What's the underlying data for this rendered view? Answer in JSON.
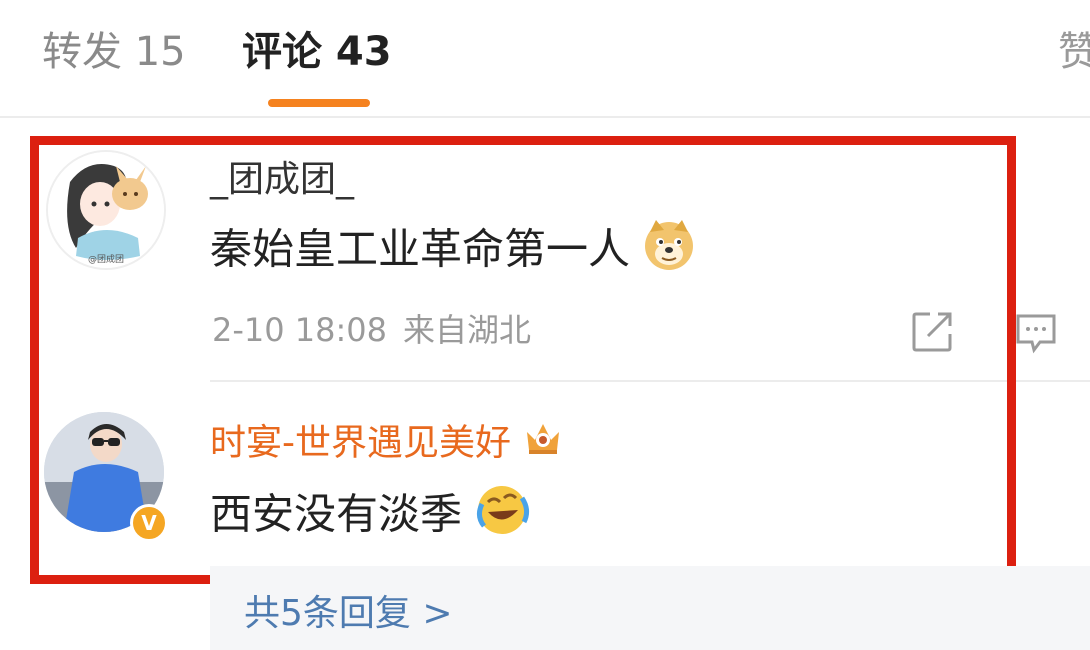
{
  "tabs": {
    "repost": "转发 15",
    "comments": "评论 43",
    "likes": "赞"
  },
  "comments": [
    {
      "username": "_团成团_",
      "text": "秦始皇工业革命第一人",
      "emoji": "doge-emoji",
      "date": "2-10 18:08",
      "location": "来自湖北"
    },
    {
      "username": "时宴-世界遇见美好",
      "text": "西安没有淡季",
      "emoji": "laugh-cry-emoji",
      "verified_badge": "V"
    }
  ],
  "replies": {
    "label": "共5条回复 >"
  },
  "colors": {
    "accent": "#f5821f",
    "highlight_border": "#dc2010",
    "vip_username": "#e8691e",
    "reply_link": "#4e7bb0",
    "verified_badge": "#f5a623"
  }
}
